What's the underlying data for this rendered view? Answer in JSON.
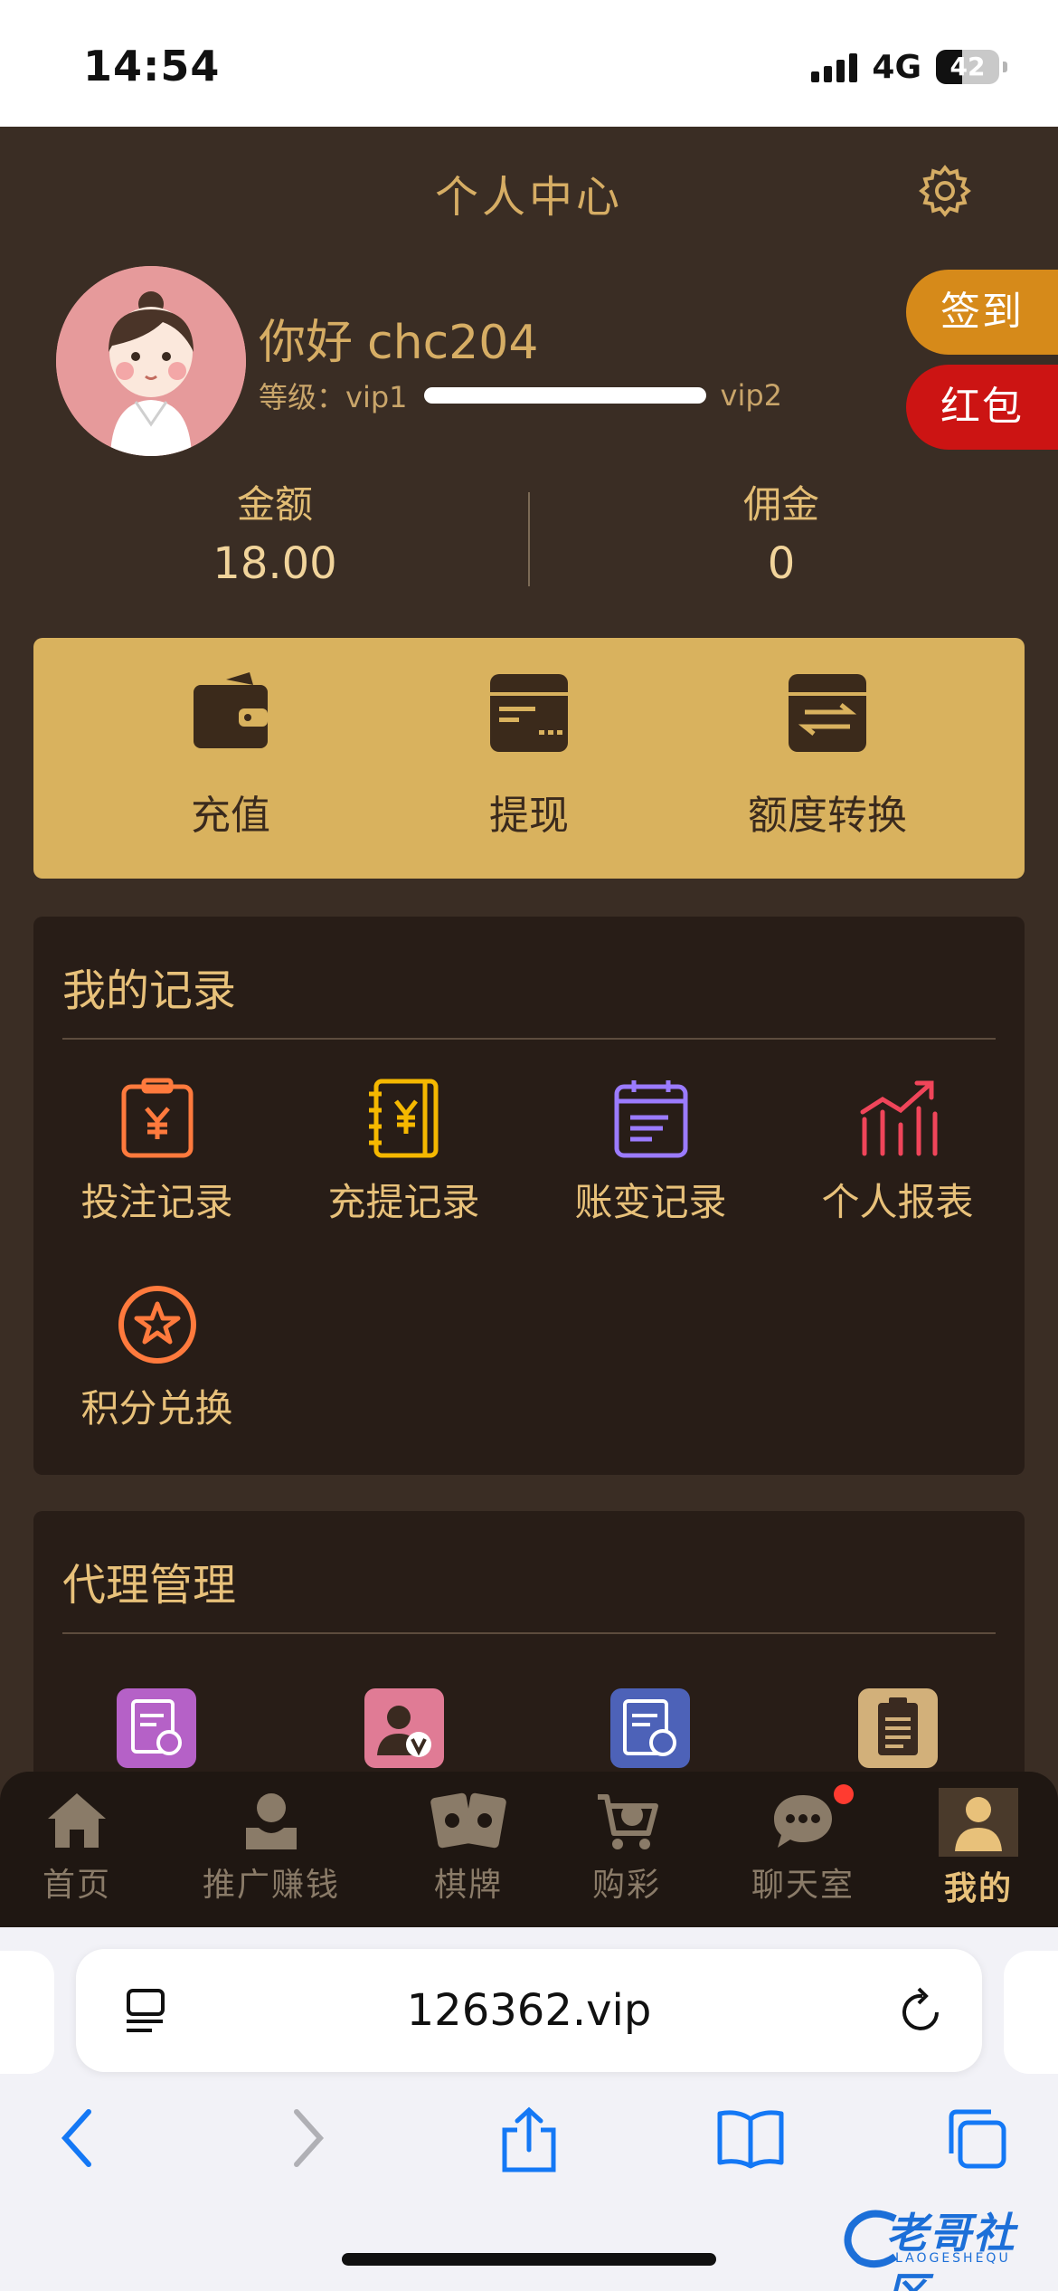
{
  "status_bar": {
    "time": "14:54",
    "network": "4G",
    "battery": "42"
  },
  "header": {
    "title": "个人中心"
  },
  "profile": {
    "greeting": "你好",
    "username": "chc204",
    "level_label": "等级：vip1",
    "next_level": "vip2",
    "level_progress": 1.0
  },
  "side_buttons": {
    "sign_in": "签到",
    "red_packet": "红包"
  },
  "stats": [
    {
      "label": "金额",
      "value": "18.00"
    },
    {
      "label": "佣金",
      "value": "0"
    }
  ],
  "quick_actions": [
    {
      "label": "充值",
      "icon": "wallet-icon"
    },
    {
      "label": "提现",
      "icon": "card-icon"
    },
    {
      "label": "额度转换",
      "icon": "transfer-icon"
    }
  ],
  "records": {
    "title": "我的记录",
    "items": [
      {
        "label": "投注记录",
        "icon": "clipboard-yen-icon",
        "color": "#ff7a3d"
      },
      {
        "label": "充提记录",
        "icon": "notebook-yen-icon",
        "color": "#f5b800"
      },
      {
        "label": "账变记录",
        "icon": "calendar-list-icon",
        "color": "#9b7bff"
      },
      {
        "label": "个人报表",
        "icon": "bar-chart-icon",
        "color": "#f0455a"
      },
      {
        "label": "积分兑换",
        "icon": "star-circle-icon",
        "color": "#ff7a3d"
      }
    ]
  },
  "agent": {
    "title": "代理管理",
    "icons": [
      "agent-card-icon",
      "vip-user-icon",
      "money-doc-icon",
      "report-doc-icon"
    ]
  },
  "tabbar": [
    {
      "label": "首页",
      "icon": "home-icon"
    },
    {
      "label": "推广赚钱",
      "icon": "promote-icon"
    },
    {
      "label": "棋牌",
      "icon": "cards-icon"
    },
    {
      "label": "购彩",
      "icon": "cart-icon"
    },
    {
      "label": "聊天室",
      "icon": "chat-icon",
      "badge": true
    },
    {
      "label": "我的",
      "icon": "user-icon",
      "active": true
    }
  ],
  "browser": {
    "url": "126362.vip"
  },
  "watermark": {
    "text": "老哥社区",
    "sub": "LAOGESHEQU"
  }
}
